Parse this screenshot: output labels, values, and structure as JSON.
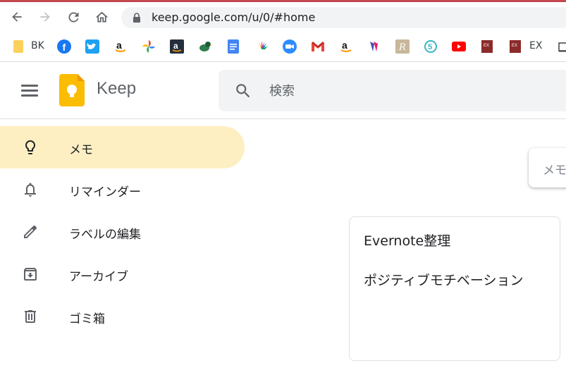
{
  "browser": {
    "url": "keep.google.com/u/0/#home",
    "bookmarks": [
      {
        "icon": "folder-icon",
        "label": "BK"
      },
      {
        "icon": "facebook-icon"
      },
      {
        "icon": "twitter-icon"
      },
      {
        "icon": "amazon-icon"
      },
      {
        "icon": "google-photos-icon"
      },
      {
        "icon": "amazon-icon"
      },
      {
        "icon": "duck-icon"
      },
      {
        "icon": "google-docs-icon"
      },
      {
        "icon": "nbc-icon"
      },
      {
        "icon": "zoom-icon"
      },
      {
        "icon": "gmail-icon"
      },
      {
        "icon": "amazon-icon"
      },
      {
        "icon": "bookmark-icon"
      },
      {
        "icon": "rakuten-icon"
      },
      {
        "icon": "five-icon"
      },
      {
        "icon": "youtube-icon"
      },
      {
        "icon": "ex-icon"
      },
      {
        "icon": "ex-icon",
        "label": "EX"
      }
    ]
  },
  "app": {
    "title": "Keep",
    "search_placeholder": "検索"
  },
  "sidebar": {
    "items": [
      {
        "label": "メモ",
        "icon": "lightbulb-icon",
        "active": true
      },
      {
        "label": "リマインダー",
        "icon": "bell-icon"
      },
      {
        "label": "ラベルの編集",
        "icon": "pencil-icon"
      },
      {
        "label": "アーカイブ",
        "icon": "archive-icon"
      },
      {
        "label": "ゴミ箱",
        "icon": "trash-icon"
      }
    ]
  },
  "main": {
    "take_note_placeholder": "メモ",
    "notes": [
      {
        "title": "Evernote整理",
        "body": "ポジティブモチベーション"
      }
    ]
  },
  "colors": {
    "accent": "#feefc3",
    "keep_yellow": "#fbbc04",
    "icon_gray": "#5f6368"
  }
}
